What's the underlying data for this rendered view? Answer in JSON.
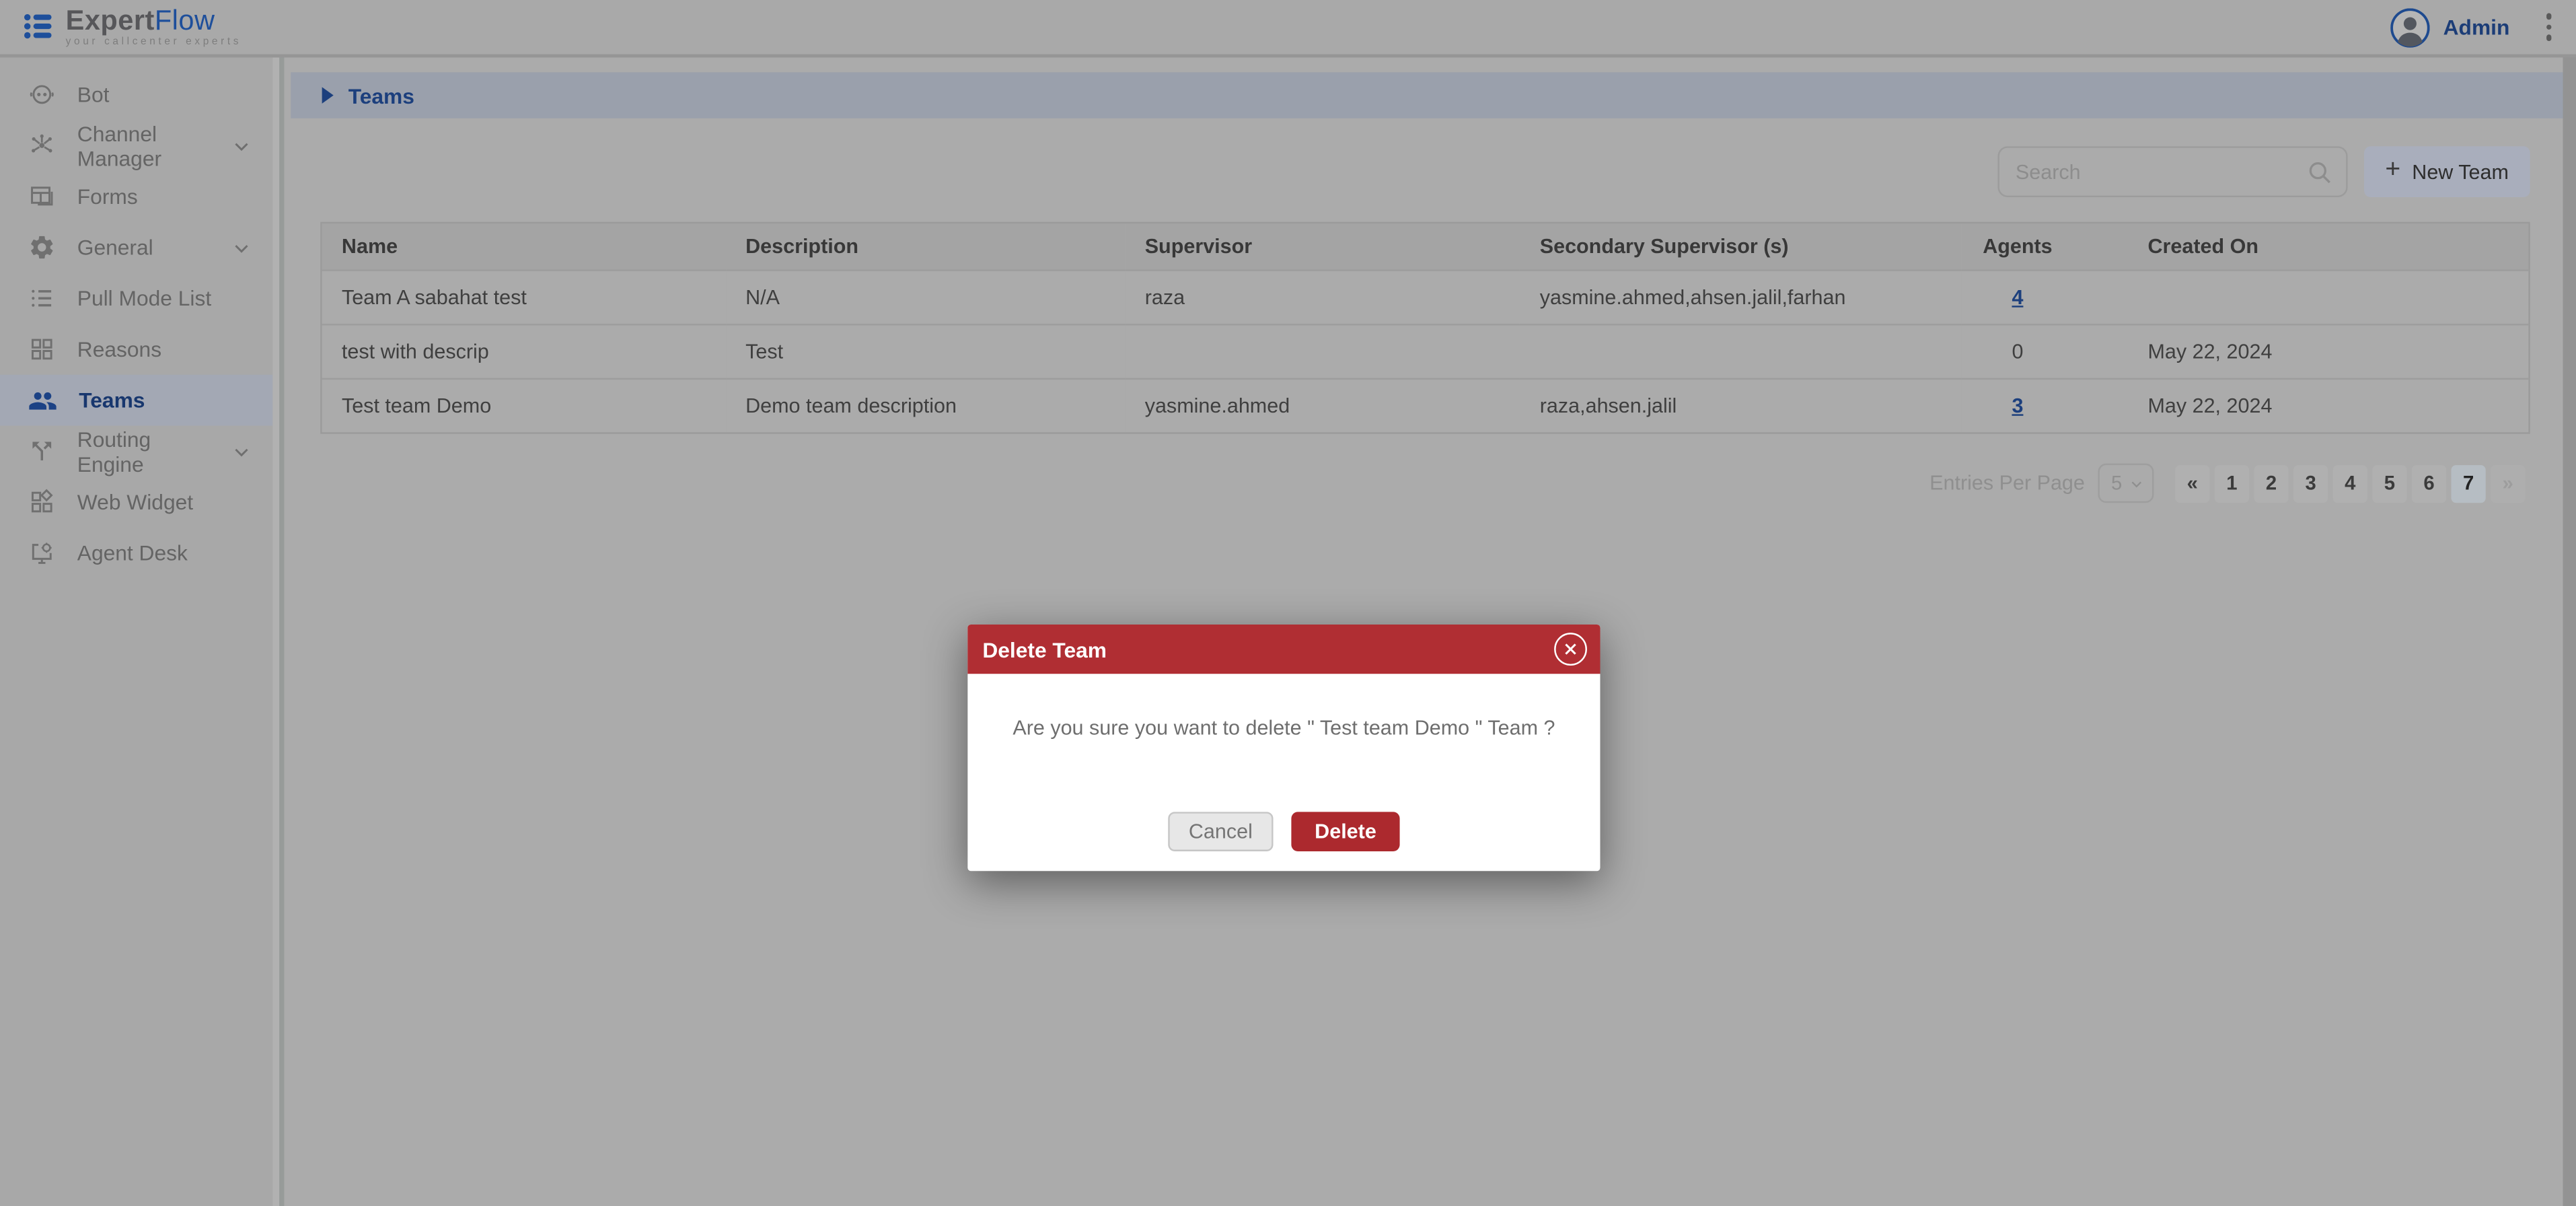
{
  "header": {
    "logo": {
      "brand_primary": "Expert",
      "brand_secondary": "Flow",
      "tagline": "your callcenter experts"
    },
    "user": {
      "name": "Admin"
    }
  },
  "sidebar": {
    "items": [
      {
        "label": "Bot",
        "icon": "bot-icon",
        "has_submenu": false,
        "selected": false
      },
      {
        "label": "Channel Manager",
        "icon": "channel-hub-icon",
        "has_submenu": true,
        "selected": false
      },
      {
        "label": "Forms",
        "icon": "forms-icon",
        "has_submenu": false,
        "selected": false
      },
      {
        "label": "General",
        "icon": "gear-icon",
        "has_submenu": true,
        "selected": false
      },
      {
        "label": "Pull Mode List",
        "icon": "list-icon",
        "has_submenu": false,
        "selected": false
      },
      {
        "label": "Reasons",
        "icon": "grid-icon",
        "has_submenu": false,
        "selected": false
      },
      {
        "label": "Teams",
        "icon": "people-icon",
        "has_submenu": false,
        "selected": true
      },
      {
        "label": "Routing Engine",
        "icon": "route-split-icon",
        "has_submenu": true,
        "selected": false
      },
      {
        "label": "Web Widget",
        "icon": "widgets-icon",
        "has_submenu": false,
        "selected": false
      },
      {
        "label": "Agent Desk",
        "icon": "desk-monitor-icon",
        "has_submenu": false,
        "selected": false
      }
    ]
  },
  "breadcrumb": {
    "label": "Teams"
  },
  "toolbar": {
    "search_placeholder": "Search",
    "new_team_label": "New Team",
    "plus_sign": "+"
  },
  "table": {
    "columns": [
      "Name",
      "Description",
      "Supervisor",
      "Secondary Supervisor (s)",
      "Agents",
      "Created On"
    ],
    "rows": [
      {
        "name": "Team A sabahat test",
        "description": "N/A",
        "supervisor": "raza",
        "secondary_supervisors": "yasmine.ahmed,ahsen.jalil,farhan",
        "agents": "4",
        "agents_is_link": true,
        "created_on": ""
      },
      {
        "name": "test with descrip",
        "description": "Test",
        "supervisor": "",
        "secondary_supervisors": "",
        "agents": "0",
        "agents_is_link": false,
        "created_on": "May 22, 2024"
      },
      {
        "name": "Test team Demo",
        "description": "Demo team description",
        "supervisor": "yasmine.ahmed",
        "secondary_supervisors": "raza,ahsen.jalil",
        "agents": "3",
        "agents_is_link": true,
        "created_on": "May 22, 2024"
      }
    ]
  },
  "pagination": {
    "entries_per_page_label": "Entries Per Page",
    "page_size": "5",
    "prev_label": "«",
    "next_label": "»",
    "pages": [
      "1",
      "2",
      "3",
      "4",
      "5",
      "6",
      "7"
    ],
    "active_page": "7"
  },
  "modal": {
    "title": "Delete Team",
    "message": "Are you sure you want to delete \" Test team Demo \" Team ?",
    "cancel_label": "Cancel",
    "delete_label": "Delete"
  },
  "colors": {
    "brand_blue": "#1e4f9b",
    "dark_blue_text": "#1c3f7d",
    "modal_header_red": "#b02e33",
    "delete_button_red": "#ac292e",
    "selected_nav_bg": "#a3a8b4",
    "breadcrumb_bar_bg": "#9aa0ac",
    "new_team_button_bg": "#a9aebc",
    "pagination_active_bg": "#b6bdc3",
    "content_bg": "#ababab"
  }
}
